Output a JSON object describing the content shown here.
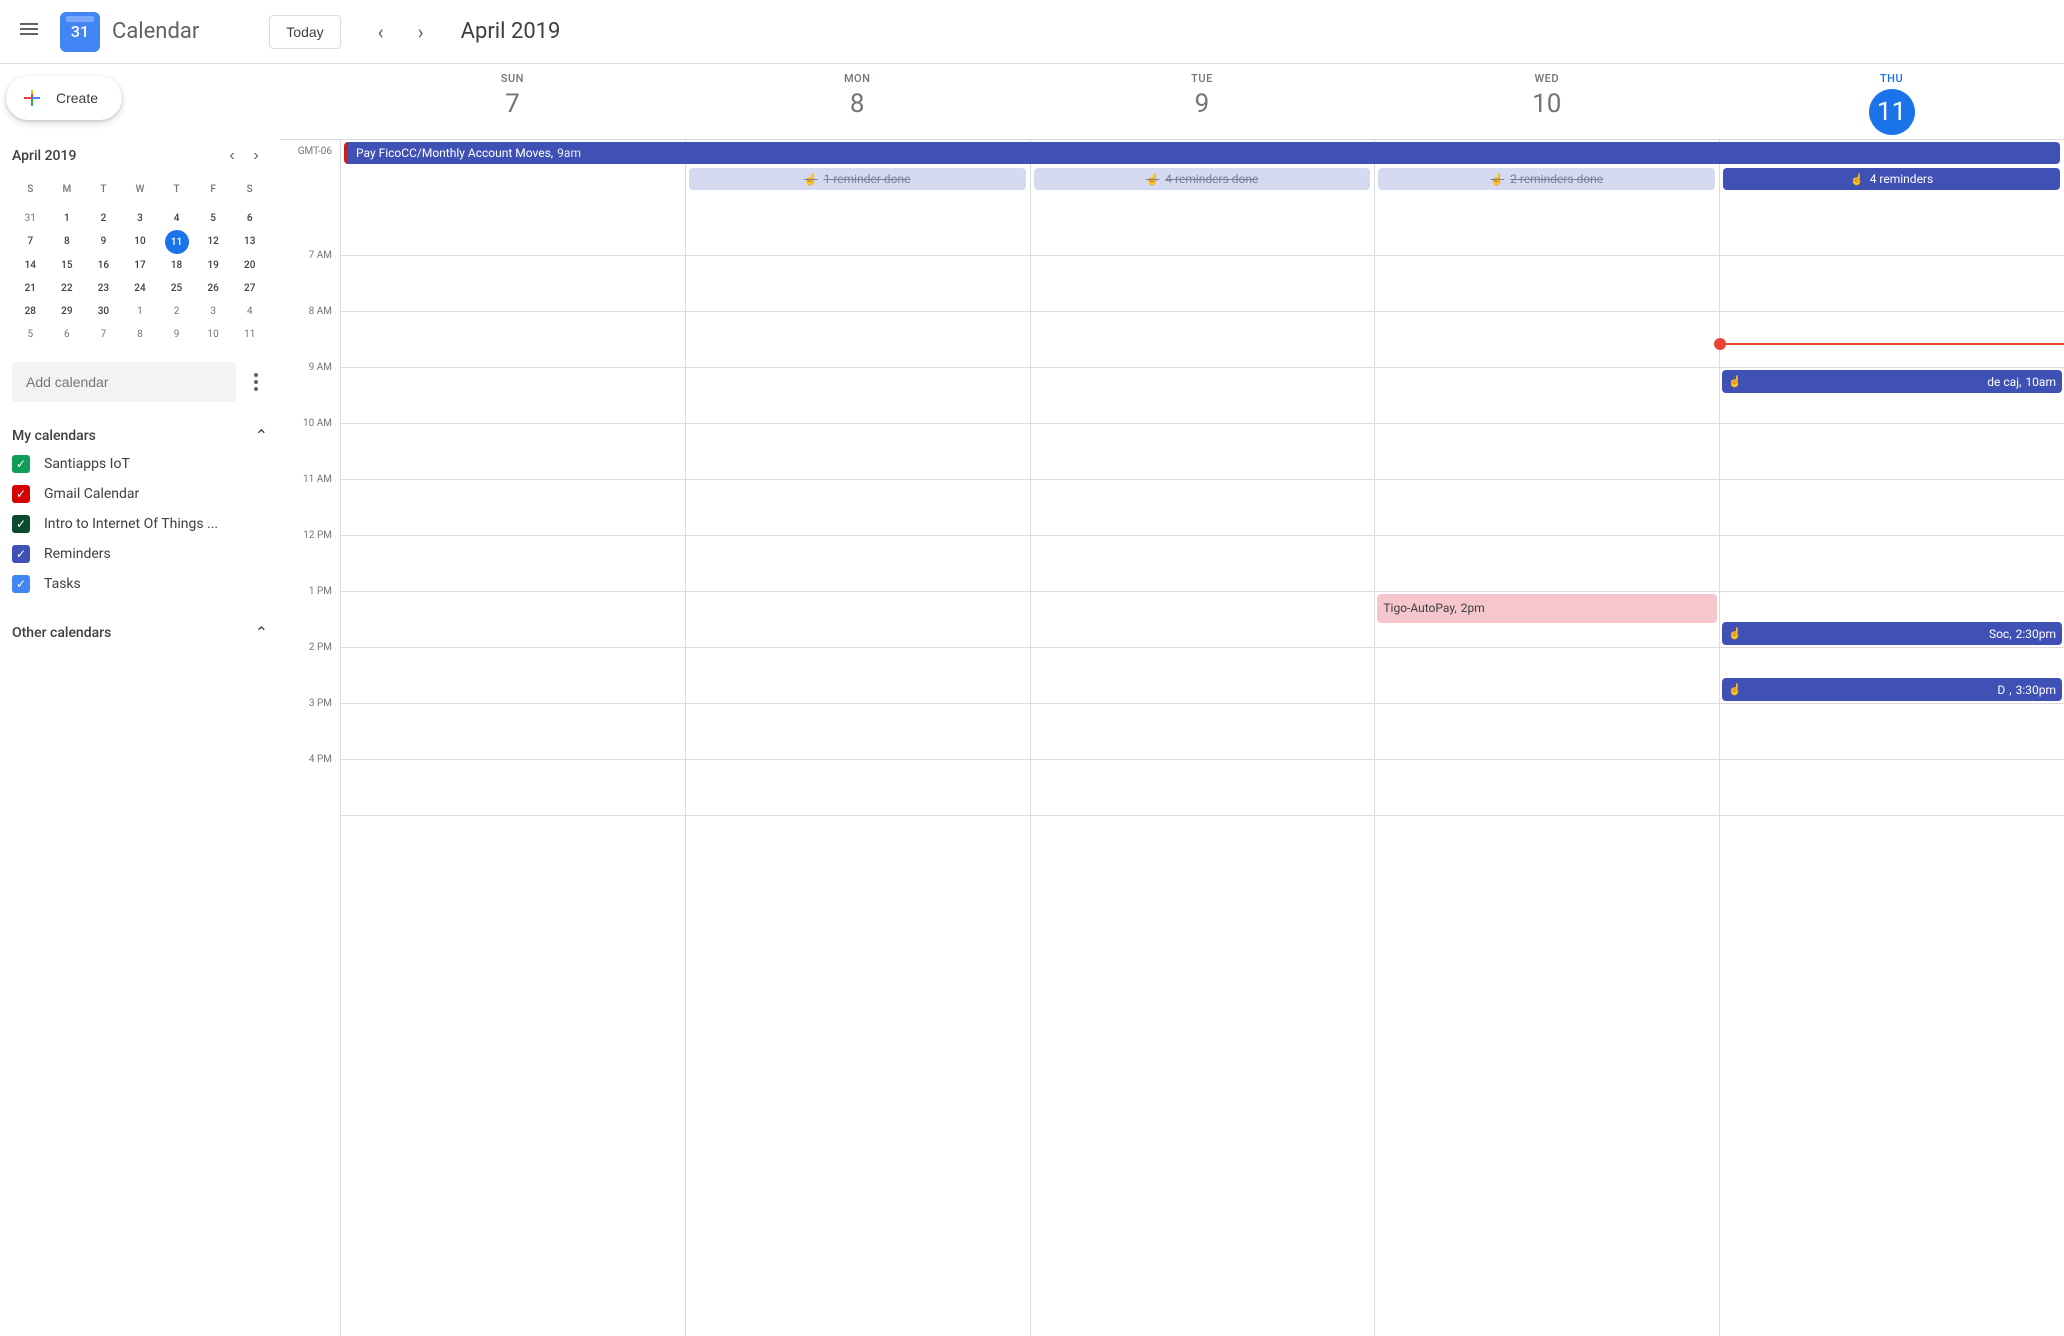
{
  "header": {
    "logo_number": "31",
    "app_name": "Calendar",
    "today_label": "Today",
    "month_title": "April 2019"
  },
  "sidebar": {
    "create_label": "Create",
    "mini_cal": {
      "title": "April 2019",
      "dow": [
        "S",
        "M",
        "T",
        "W",
        "T",
        "F",
        "S"
      ],
      "weeks": [
        [
          {
            "d": "31",
            "o": true
          },
          {
            "d": "1"
          },
          {
            "d": "2"
          },
          {
            "d": "3"
          },
          {
            "d": "4"
          },
          {
            "d": "5"
          },
          {
            "d": "6"
          }
        ],
        [
          {
            "d": "7"
          },
          {
            "d": "8"
          },
          {
            "d": "9"
          },
          {
            "d": "10"
          },
          {
            "d": "11",
            "today": true
          },
          {
            "d": "12"
          },
          {
            "d": "13"
          }
        ],
        [
          {
            "d": "14"
          },
          {
            "d": "15"
          },
          {
            "d": "16"
          },
          {
            "d": "17"
          },
          {
            "d": "18"
          },
          {
            "d": "19"
          },
          {
            "d": "20"
          }
        ],
        [
          {
            "d": "21"
          },
          {
            "d": "22"
          },
          {
            "d": "23"
          },
          {
            "d": "24"
          },
          {
            "d": "25"
          },
          {
            "d": "26"
          },
          {
            "d": "27"
          }
        ],
        [
          {
            "d": "28"
          },
          {
            "d": "29"
          },
          {
            "d": "30"
          },
          {
            "d": "1",
            "o": true
          },
          {
            "d": "2",
            "o": true
          },
          {
            "d": "3",
            "o": true
          },
          {
            "d": "4",
            "o": true
          }
        ],
        [
          {
            "d": "5",
            "o": true
          },
          {
            "d": "6",
            "o": true
          },
          {
            "d": "7",
            "o": true
          },
          {
            "d": "8",
            "o": true
          },
          {
            "d": "9",
            "o": true
          },
          {
            "d": "10",
            "o": true
          },
          {
            "d": "11",
            "o": true
          }
        ]
      ]
    },
    "add_calendar_placeholder": "Add calendar",
    "my_calendars_label": "My calendars",
    "other_calendars_label": "Other calendars",
    "calendars": [
      {
        "name": "Santiapps IoT",
        "color": "#0f9d58"
      },
      {
        "name": "Gmail Calendar",
        "color": "#d50000"
      },
      {
        "name": "Intro to Internet Of Things ...",
        "color": "#0b4a2f"
      },
      {
        "name": "Reminders",
        "color": "#3f51b5"
      },
      {
        "name": "Tasks",
        "color": "#4285f4"
      }
    ]
  },
  "week": {
    "timezone": "GMT-06",
    "days": [
      {
        "dow": "SUN",
        "num": "7"
      },
      {
        "dow": "MON",
        "num": "8"
      },
      {
        "dow": "TUE",
        "num": "9"
      },
      {
        "dow": "WED",
        "num": "10"
      },
      {
        "dow": "THU",
        "num": "11",
        "today": true
      }
    ],
    "allday_event": {
      "title": "Pay FicoCC/Monthly Account Moves,",
      "time": "9am"
    },
    "reminder_chips": [
      {
        "col": 1,
        "label": "1 reminder done",
        "done": true
      },
      {
        "col": 2,
        "label": "4 reminders done",
        "done": true
      },
      {
        "col": 3,
        "label": "2 reminders done",
        "done": true
      },
      {
        "col": 4,
        "label": "4 reminders",
        "done": false
      }
    ],
    "hours": [
      "7 AM",
      "8 AM",
      "9 AM",
      "10 AM",
      "11 AM",
      "12 PM",
      "1 PM",
      "2 PM",
      "3 PM",
      "4 PM"
    ],
    "now_hour_offset": 2.55,
    "now_col": 4,
    "events": [
      {
        "col": 4,
        "hour": 3,
        "title": "de caj,",
        "time": "10am",
        "icon": true
      },
      {
        "col": 3,
        "hour": 7,
        "title": "Tigo-AutoPay,",
        "time": "2pm",
        "pink": true,
        "dur": 0.55
      },
      {
        "col": 4,
        "hour": 7.5,
        "title": "Soc,",
        "time": "2:30pm",
        "icon": true
      },
      {
        "col": 4,
        "hour": 8.5,
        "title": "D",
        "time": "3:30pm",
        "icon": true,
        "extra": ","
      }
    ]
  }
}
